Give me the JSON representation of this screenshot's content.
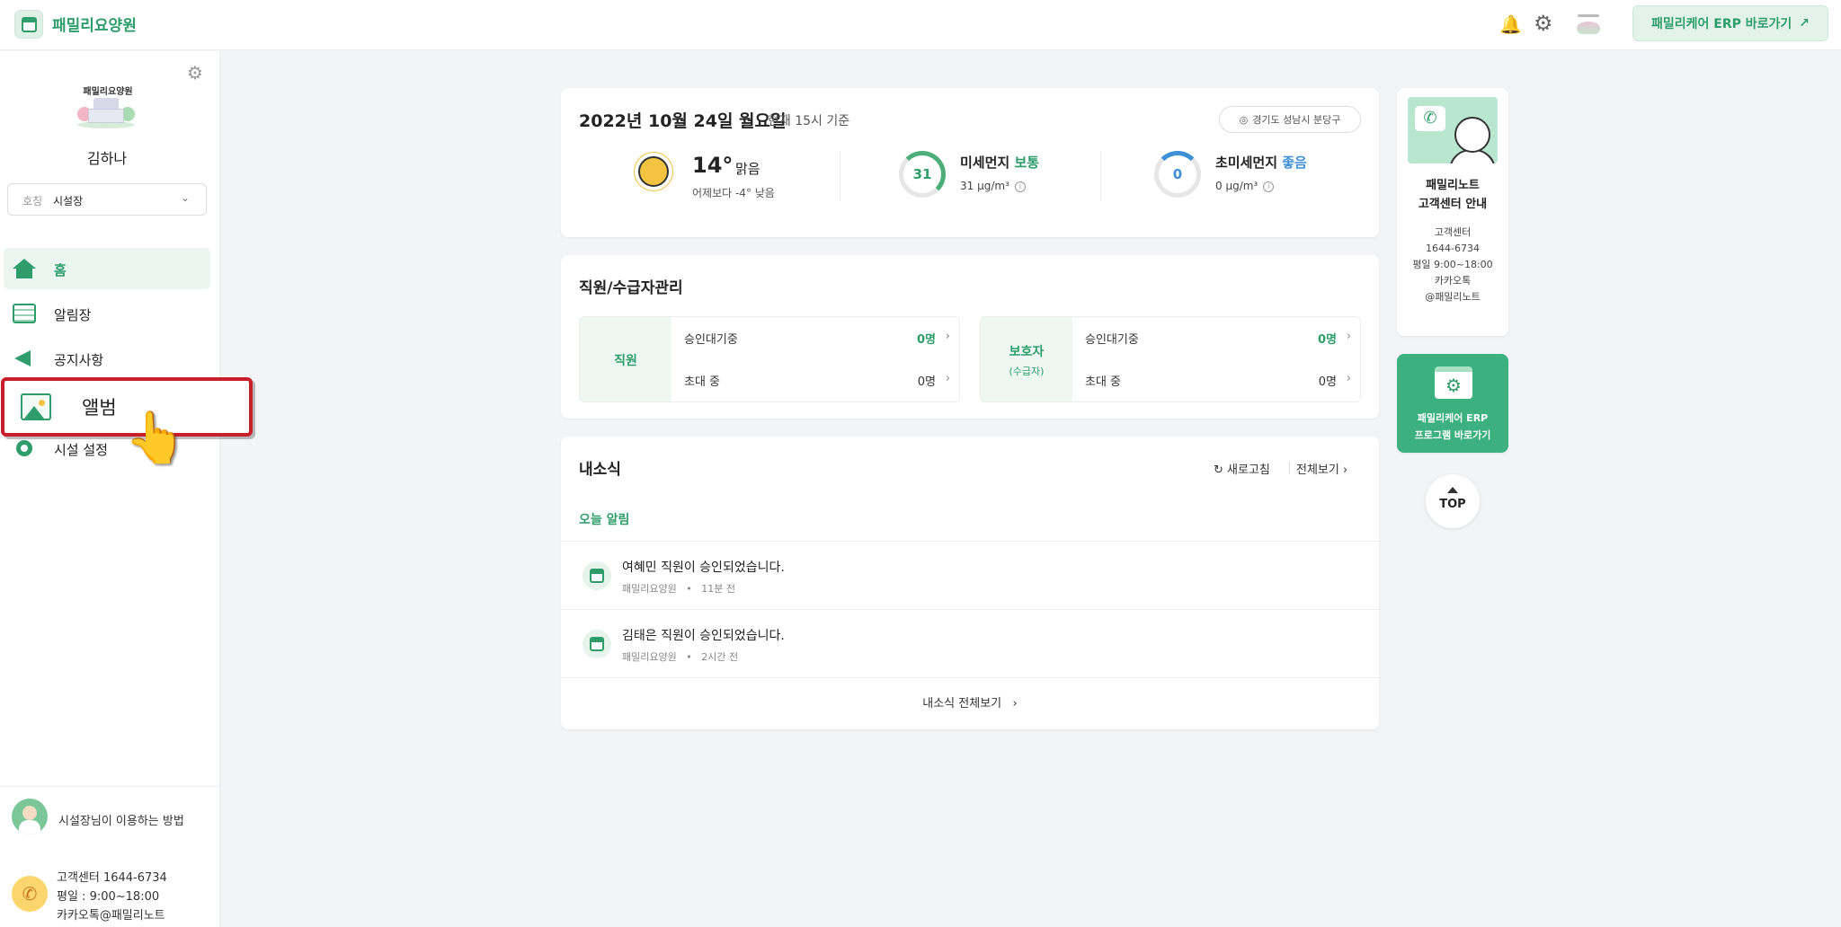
{
  "topbar": {
    "brand": "패밀리요양원",
    "erp_button": "패밀리케어 ERP 바로가기",
    "erp_arrow": "↗",
    "bell_icon": "bell-icon",
    "gear_icon": "gear-icon"
  },
  "sidebar": {
    "facility_name": "패밀리요양원",
    "user_name": "김하나",
    "role_label": "호칭",
    "role_value": "시설장",
    "items": [
      {
        "label": "홈",
        "icon": "home-icon",
        "active": true
      },
      {
        "label": "알림장",
        "icon": "notebook-icon"
      },
      {
        "label": "공지사항",
        "icon": "megaphone-icon"
      },
      {
        "label": "앨범",
        "icon": "album-icon",
        "highlighted": true
      },
      {
        "label": "시설 설정",
        "icon": "settings-icon"
      }
    ],
    "guide_label": "시설장님이 이용하는 방법",
    "cs_lines": [
      "고객센터 1644-6734",
      "평일 : 9:00~18:00",
      "카카오톡@패밀리노트"
    ]
  },
  "weather": {
    "date": "2022년 10월 24일 월요일",
    "basis": "현재 15시 기준",
    "location": "경기도 성남시 분당구",
    "temp": "14°",
    "condition": "맑음",
    "comparison": "어제보다 -4° 낮음",
    "pm10": {
      "name": "미세먼지",
      "status": "보통",
      "value": "31",
      "unit_value": "31 μg/m³"
    },
    "pm25": {
      "name": "초미세먼지",
      "status": "좋음",
      "value": "0",
      "unit_value": "0 μg/m³"
    }
  },
  "management": {
    "title": "직원/수급자관리",
    "staff": {
      "tag": "직원",
      "rows": [
        {
          "label": "승인대기중",
          "count": "0명"
        },
        {
          "label": "초대 중",
          "count": "0명"
        }
      ]
    },
    "guardian": {
      "tag": "보호자",
      "sub": "(수급자)",
      "rows": [
        {
          "label": "승인대기중",
          "count": "0명"
        },
        {
          "label": "초대 중",
          "count": "0명"
        }
      ]
    }
  },
  "news": {
    "title": "내소식",
    "refresh": "새로고침",
    "view_all": "전체보기",
    "today_label": "오늘 알림",
    "items": [
      {
        "title": "여혜민 직원이 승인되었습니다.",
        "source": "패밀리요양원",
        "time": "11분 전"
      },
      {
        "title": "김태은 직원이 승인되었습니다.",
        "source": "패밀리요양원",
        "time": "2시간 전"
      }
    ],
    "footer": "내소식 전체보기"
  },
  "right": {
    "cs_title_1": "패밀리노트",
    "cs_title_2": "고객센터 안내",
    "cs_info": [
      "고객센터",
      "1644-6734",
      "평일 9:00~18:00",
      "카카오톡",
      "@패밀리노트"
    ],
    "erp_1": "패밀리케어 ERP",
    "erp_2": "프로그램 바로가기",
    "top": "TOP"
  },
  "colors": {
    "accent": "#2e9d6b",
    "highlight": "#c8202a",
    "blue": "#3d8fd6"
  }
}
